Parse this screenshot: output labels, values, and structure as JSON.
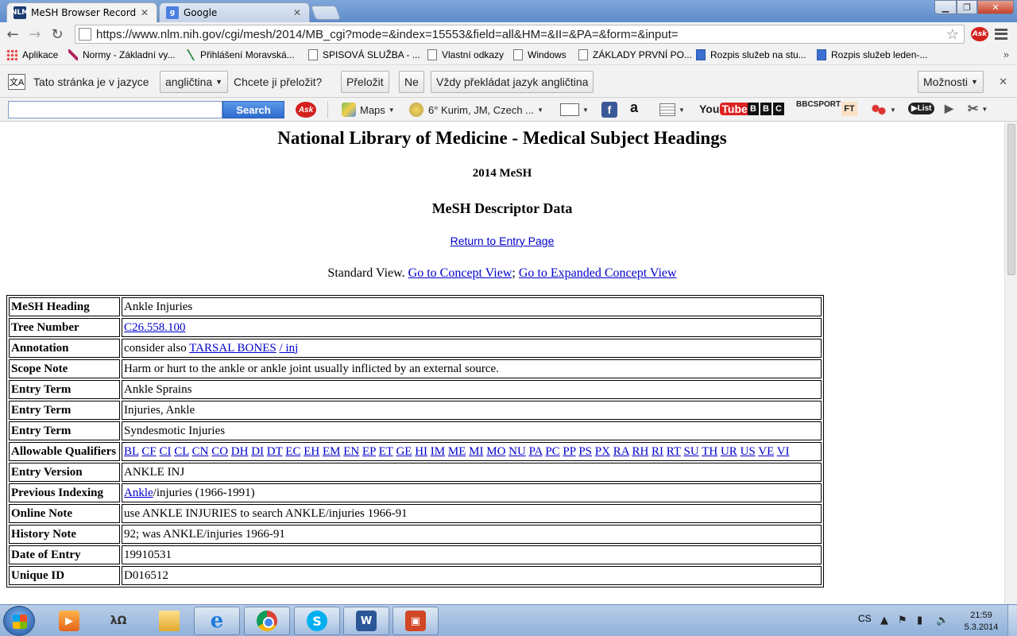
{
  "browser": {
    "tabs": [
      {
        "title": "MeSH Browser Record",
        "favicon": "NLM"
      },
      {
        "title": "Google",
        "favicon": "g"
      }
    ],
    "address_url": "https://www.nlm.nih.gov/cgi/mesh/2014/MB_cgi?mode=&index=15553&field=all&HM=&II=&PA=&form=&input=",
    "bookmarks": [
      {
        "label": "Aplikace",
        "icon": "apps-icon"
      },
      {
        "label": "Normy - Základní vy...",
        "icon": "pen-icon"
      },
      {
        "label": "Přihlášení  Moravská...",
        "icon": "chart-icon"
      },
      {
        "label": "SPISOVÁ SLUŽBA - ...",
        "icon": "page-icon"
      },
      {
        "label": "Vlastní odkazy",
        "icon": "page-icon"
      },
      {
        "label": "Windows",
        "icon": "page-icon"
      },
      {
        "label": "ZÁKLADY PRVNÍ PO...",
        "icon": "page-icon"
      },
      {
        "label": "Rozpis služeb na stu...",
        "icon": "doc-icon"
      },
      {
        "label": "Rozpis služeb leden-...",
        "icon": "doc-icon"
      }
    ],
    "bookmarks_more": "»"
  },
  "translate_bar": {
    "text_prefix": "Tato stránka je v jazyce",
    "language": "angličtina",
    "question": "Chcete ji přeložit?",
    "translate_button": "Přeložit",
    "no_button": "Ne",
    "always_button": "Vždy překládat jazyk angličtina",
    "options_button": "Možnosti"
  },
  "ext_toolbar": {
    "search_button": "Search",
    "ask_label": "Ask",
    "maps_label": "Maps",
    "weather_label": "6° Kurim, JM, Czech ...",
    "amazon_label": "a",
    "youtube_you": "You",
    "youtube_tube": "Tube",
    "bbc_letters": [
      "B",
      "B",
      "C"
    ],
    "bbc_sport_line1": "BBC",
    "bbc_sport_line2": "SPORT",
    "ft_label": "FT",
    "listen_label": "List"
  },
  "page": {
    "title": "National Library of Medicine - Medical Subject Headings",
    "subtitle": "2014 MeSH",
    "section": "MeSH Descriptor Data",
    "return_link": "Return to Entry Page",
    "standard_view": "Standard View.",
    "concept_view_link": "Go to Concept View",
    "separator": ";",
    "expanded_view_link": "Go to Expanded Concept View",
    "rows": {
      "heading": {
        "label": "MeSH Heading",
        "value": "Ankle Injuries"
      },
      "tree": {
        "label": "Tree Number",
        "link": "C26.558.100"
      },
      "annotation": {
        "label": "Annotation",
        "prefix": "consider also",
        "link1": "TARSAL BONES",
        "slash": "/",
        "link2": " inj"
      },
      "scope": {
        "label": "Scope Note",
        "value": "Harm or hurt to the ankle or ankle joint usually inflicted by an external source."
      },
      "entry1": {
        "label": "Entry Term",
        "value": "Ankle Sprains"
      },
      "entry2": {
        "label": "Entry Term",
        "value": "Injuries, Ankle"
      },
      "entry3": {
        "label": "Entry Term",
        "value": "Syndesmotic Injuries"
      },
      "qualifiers": {
        "label": "Allowable Qualifiers",
        "codes": [
          "BL",
          "CF",
          "CI",
          "CL",
          "CN",
          "CO",
          "DH",
          "DI",
          "DT",
          "EC",
          "EH",
          "EM",
          "EN",
          "EP",
          "ET",
          "GE",
          "HI",
          "IM",
          "ME",
          "MI",
          "MO",
          "NU",
          "PA",
          "PC",
          "PP",
          "PS",
          "PX",
          "RA",
          "RH",
          "RI",
          "RT",
          "SU",
          "TH",
          "UR",
          "US",
          "VE",
          "VI"
        ]
      },
      "version": {
        "label": "Entry Version",
        "value": "ANKLE INJ"
      },
      "previous": {
        "label": "Previous Indexing",
        "link": "Ankle",
        "suffix": "/injuries (1966-1991)"
      },
      "online": {
        "label": "Online Note",
        "value": "use ANKLE INJURIES to search ANKLE/injuries 1966-91"
      },
      "history": {
        "label": "History Note",
        "value": "92; was ANKLE/injuries 1966-91"
      },
      "date": {
        "label": "Date of Entry",
        "value": "19910531"
      },
      "uid": {
        "label": "Unique ID",
        "value": "D016512"
      }
    }
  },
  "taskbar": {
    "language": "CS",
    "time": "21:59",
    "date": "5.3.2014",
    "word_label": "W",
    "skype_label": "S"
  },
  "colors": {
    "link": "#0000cc",
    "taskbar": "#8fb1da",
    "search_button": "#2e6dcf"
  }
}
